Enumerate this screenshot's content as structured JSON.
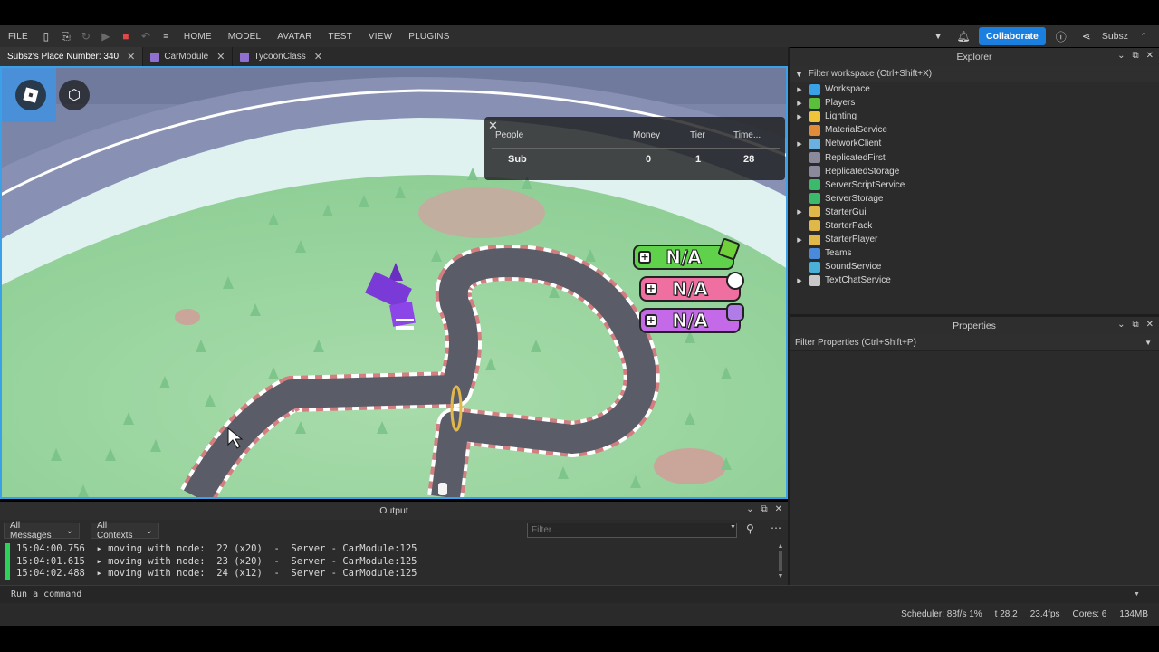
{
  "menubar": {
    "items": [
      "FILE",
      "HOME",
      "MODEL",
      "AVATAR",
      "TEST",
      "VIEW",
      "PLUGINS"
    ],
    "collaborate_label": "Collaborate",
    "user": "Subsz"
  },
  "tabs": [
    {
      "label": "Subsz's Place Number: 340"
    },
    {
      "label": "CarModule"
    },
    {
      "label": "TycoonClass"
    }
  ],
  "leaderboard": {
    "headers": {
      "people": "People",
      "money": "Money",
      "tier": "Tier",
      "time": "Time..."
    },
    "row": {
      "name": "Sub",
      "money": "0",
      "tier": "1",
      "time": "28"
    }
  },
  "currency_pills": [
    {
      "text": "N/A",
      "color": "#5fd14a",
      "badge": "#6fd13a"
    },
    {
      "text": "N/A",
      "color": "#ef6fa0",
      "badge": "#ffffff"
    },
    {
      "text": "N/A",
      "color": "#c46ae8",
      "badge": "#b07de8"
    }
  ],
  "explorer": {
    "title": "Explorer",
    "filter_placeholder": "Filter workspace (Ctrl+Shift+X)",
    "items": [
      {
        "label": "Workspace",
        "expandable": true,
        "color": "#3aa0e8"
      },
      {
        "label": "Players",
        "expandable": true,
        "color": "#5bbf3c"
      },
      {
        "label": "Lighting",
        "expandable": true,
        "color": "#f0c43a"
      },
      {
        "label": "MaterialService",
        "expandable": false,
        "color": "#e08a3a"
      },
      {
        "label": "NetworkClient",
        "expandable": true,
        "color": "#6ab0e0"
      },
      {
        "label": "ReplicatedFirst",
        "expandable": false,
        "color": "#8a8a9a"
      },
      {
        "label": "ReplicatedStorage",
        "expandable": false,
        "color": "#8a8a9a"
      },
      {
        "label": "ServerScriptService",
        "expandable": false,
        "color": "#3aba6a"
      },
      {
        "label": "ServerStorage",
        "expandable": false,
        "color": "#3aba6a"
      },
      {
        "label": "StarterGui",
        "expandable": true,
        "color": "#e0b84a"
      },
      {
        "label": "StarterPack",
        "expandable": false,
        "color": "#e0b84a"
      },
      {
        "label": "StarterPlayer",
        "expandable": true,
        "color": "#e0b84a"
      },
      {
        "label": "Teams",
        "expandable": false,
        "color": "#4a8ad8"
      },
      {
        "label": "SoundService",
        "expandable": false,
        "color": "#4ab0d8"
      },
      {
        "label": "TextChatService",
        "expandable": true,
        "color": "#c8c8c8"
      }
    ]
  },
  "properties": {
    "title": "Properties",
    "filter_placeholder": "Filter Properties (Ctrl+Shift+P)"
  },
  "output": {
    "title": "Output",
    "messages_filter": "All Messages",
    "contexts_filter": "All Contexts",
    "filter_placeholder": "Filter...",
    "lines": [
      "15:04:00.756  ▸ moving with node:  22 (x20)  -  Server - CarModule:125",
      "15:04:01.615  ▸ moving with node:  23 (x20)  -  Server - CarModule:125",
      "15:04:02.488  ▸ moving with node:  24 (x12)  -  Server - CarModule:125"
    ]
  },
  "command_bar": {
    "placeholder": "Run a command"
  },
  "status": {
    "scheduler": "Scheduler: 88f/s 1%",
    "t": "t 28.2",
    "fps": "23.4fps",
    "cores": "Cores: 6",
    "memory": "134MB"
  }
}
